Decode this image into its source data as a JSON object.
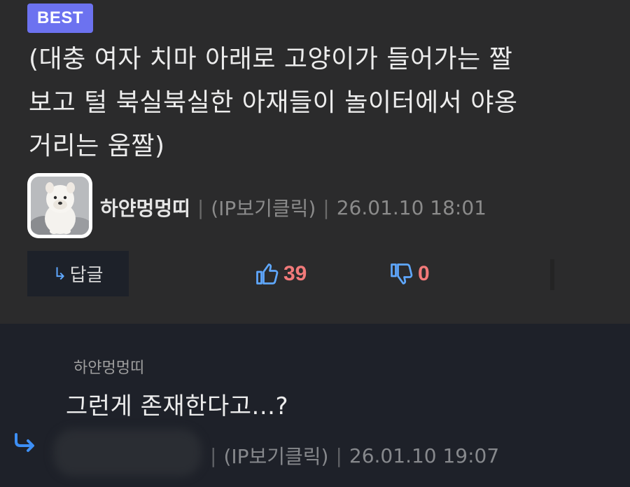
{
  "best_comment": {
    "badge": "BEST",
    "text": "(대충 여자 치마 아래로 고양이가 들어가는 짤\n보고 털 북실북실한 아재들이 놀이터에서 야옹\n거리는 움짤)",
    "author": "하얀멍멍띠",
    "ip_link": "(IP보기클릭)",
    "timestamp": "26.01.10 18:01",
    "separator": "|",
    "reply_label": "답글",
    "upvotes": "39",
    "downvotes": "0"
  },
  "reply": {
    "author": "하얀멍멍띠",
    "text": "그런게 존재한다고...?",
    "ip_link": "(IP보기클릭)",
    "timestamp": "26.01.10 19:07",
    "separator": "|"
  },
  "colors": {
    "badge": "#6c72f0",
    "vote_count": "#f27a7a",
    "accent_blue": "#5fa8ff"
  },
  "icons": {
    "reply_arrow": "reply-arrow-icon",
    "thumbs_up": "thumbs-up-icon",
    "thumbs_down": "thumbs-down-icon"
  }
}
